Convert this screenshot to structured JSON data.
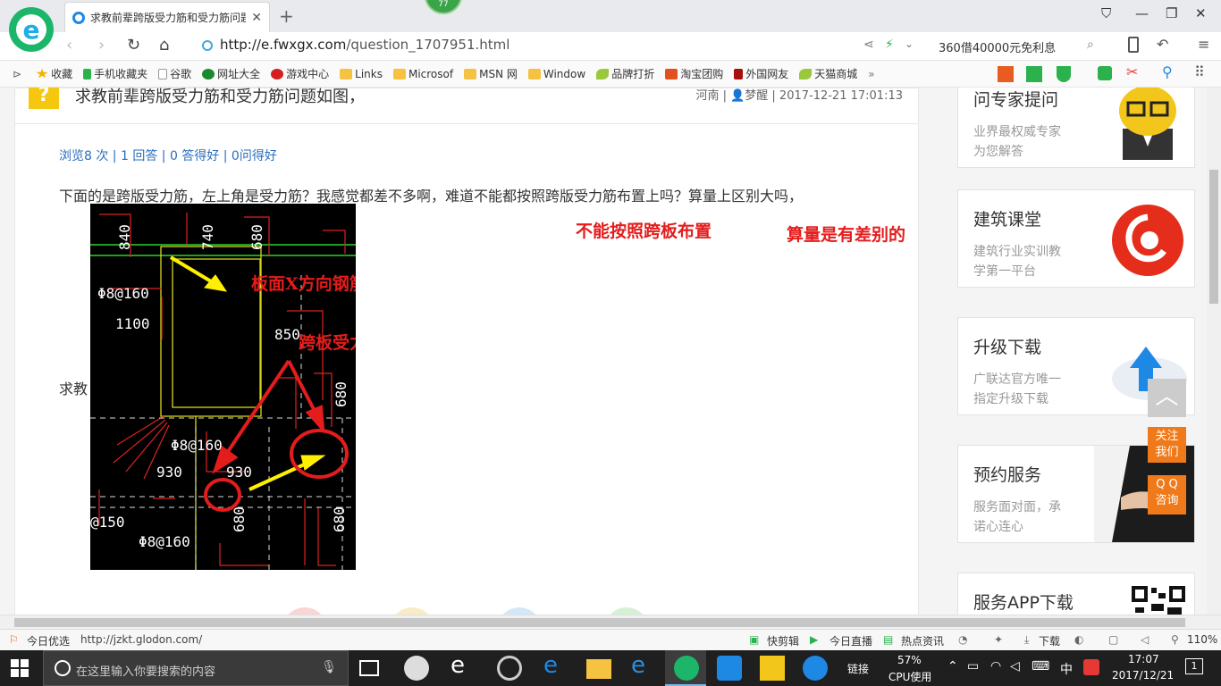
{
  "browser": {
    "tab_title": "求教前辈跨版受力筋和受力筋问题",
    "badge_count": "77",
    "url_host": "http://e.fwxgx.com",
    "url_path": "/question_1707951.html",
    "ad_text": "360借40000元免利息"
  },
  "bookmarks": [
    {
      "label": "收藏",
      "icon": "star-icon"
    },
    {
      "label": "手机收藏夹",
      "icon": "phone-icon"
    },
    {
      "label": "谷歌",
      "icon": "page-icon"
    },
    {
      "label": "网址大全",
      "icon": "globe-icon"
    },
    {
      "label": "游戏中心",
      "icon": "game-icon"
    },
    {
      "label": "Links",
      "icon": "folder-icon"
    },
    {
      "label": "Microsof",
      "icon": "folder-icon"
    },
    {
      "label": "MSN 网",
      "icon": "folder-icon"
    },
    {
      "label": "Window",
      "icon": "folder-icon"
    },
    {
      "label": "品牌打折",
      "icon": "leaf-icon"
    },
    {
      "label": "淘宝团购",
      "icon": "taobao-icon"
    },
    {
      "label": "外国网友",
      "icon": "flag-icon"
    },
    {
      "label": "天猫商城",
      "icon": "leaf-icon"
    }
  ],
  "question": {
    "title": "求教前辈跨版受力筋和受力筋问题如图，",
    "meta": "河南 | 👤梦醒 | 2017-12-21 17:01:13",
    "stats": "浏览8 次 | 1 回答 | 0 答得好 | 0问得好",
    "body": "下面的是跨版受力筋，左上角是受力筋？我感觉都差不多啊，难道不能都按照跨版受力筋布置上吗？算量上区别大吗，",
    "body2": "求教",
    "annotation_1": "不能按照跨板布置",
    "annotation_2": "算量是有差别的"
  },
  "cad": {
    "label_x_rebar": "板面X方向钢筋",
    "label_span_rebar": "跨板受力钢筋",
    "dims": [
      "840",
      "740",
      "680",
      "Φ8@160",
      "1100",
      "850",
      "680",
      "Φ8@160",
      "930",
      "930",
      "@150",
      "680",
      "680",
      "Φ8@160"
    ]
  },
  "sidebar": [
    {
      "title": "问专家提问",
      "line1": "业界最权威专家",
      "line2": "为您解答"
    },
    {
      "title": "建筑课堂",
      "line1": "建筑行业实训教",
      "line2": "学第一平台"
    },
    {
      "title": "升级下载",
      "line1": "广联达官方唯一",
      "line2": "指定升级下载"
    },
    {
      "title": "预约服务",
      "line1": "服务面对面，承",
      "line2": "诺心连心"
    },
    {
      "title": "服务APP下载",
      "line1": "",
      "line2": ""
    }
  ],
  "float": {
    "follow": "关注我们",
    "qq": "Q Q咨询"
  },
  "statusbar": {
    "today": "今日优选",
    "link": "http://jzkt.glodon.com/",
    "items": [
      "快剪辑",
      "今日直播",
      "热点资讯"
    ],
    "download": "下载",
    "zoom": "110%"
  },
  "taskbar": {
    "search_placeholder": "在这里输入你要搜索的内容",
    "link_label": "链接",
    "cpu_percent": "57%",
    "cpu_label": "CPU使用",
    "ime": "中",
    "time": "17:07",
    "date": "2017/12/21",
    "notif_count": "1"
  },
  "colors": {
    "accent": "#1cb66a",
    "link": "#2a6ebb",
    "annotation": "#e51c1c",
    "orange": "#f07a1a"
  }
}
